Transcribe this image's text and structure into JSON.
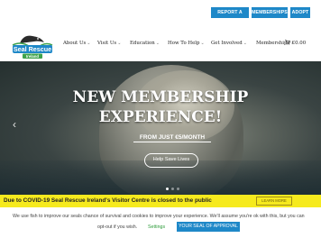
{
  "top_bar": {
    "report_label": "REPORT A SEAL",
    "memberships_label": "MEMBERSHIPS",
    "adopt_label": "ADOPT",
    "accent_color": "#1e88c8"
  },
  "logo": {
    "line1": "Seal Rescue",
    "line2": "Ireland"
  },
  "nav": {
    "items": [
      {
        "label": "About Us"
      },
      {
        "label": "Visit Us"
      },
      {
        "label": "Education"
      },
      {
        "label": "How To Help"
      },
      {
        "label": "Get Involved"
      },
      {
        "label": "Memberships"
      }
    ],
    "cart_label": "€0.00",
    "chevron_icon": "chevron-down-icon",
    "cart_icon": "cart-icon"
  },
  "hero": {
    "title_line1": "NEW MEMBERSHIP",
    "title_line2": "EXPERIENCE!",
    "subtitle": "FROM JUST €5/MONTH",
    "button_label": "Help Save Lives",
    "prev_icon": "chevron-left-icon",
    "slide_count": 3,
    "active_slide": 1
  },
  "notice": {
    "text": "Due to COVID-19 Seal Rescue Ireland's Visitor Centre is closed to the public",
    "button_label": "LEARN MORE",
    "background": "#f6ea1e"
  },
  "cookie": {
    "line1": "We use fish to improve our seals chance of survival and cookies to improve your experience. We'll assume you're ok with this, but you can",
    "line2_prefix": "opt-out if you wish.",
    "settings_label": "Settings",
    "accept_label": "YOUR SEAL OF APPROVAL"
  }
}
